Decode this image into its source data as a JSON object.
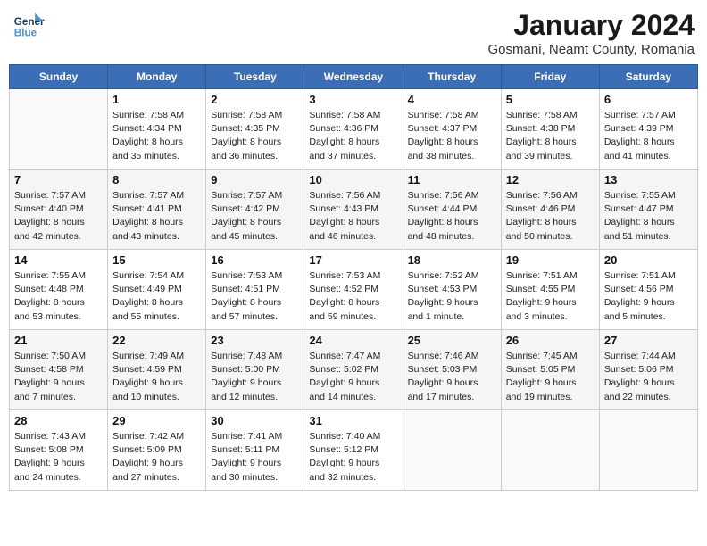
{
  "logo": {
    "line1": "General",
    "line2": "Blue"
  },
  "title": "January 2024",
  "subtitle": "Gosmani, Neamt County, Romania",
  "headers": [
    "Sunday",
    "Monday",
    "Tuesday",
    "Wednesday",
    "Thursday",
    "Friday",
    "Saturday"
  ],
  "weeks": [
    [
      {
        "day": "",
        "detail": ""
      },
      {
        "day": "1",
        "detail": "Sunrise: 7:58 AM\nSunset: 4:34 PM\nDaylight: 8 hours\nand 35 minutes."
      },
      {
        "day": "2",
        "detail": "Sunrise: 7:58 AM\nSunset: 4:35 PM\nDaylight: 8 hours\nand 36 minutes."
      },
      {
        "day": "3",
        "detail": "Sunrise: 7:58 AM\nSunset: 4:36 PM\nDaylight: 8 hours\nand 37 minutes."
      },
      {
        "day": "4",
        "detail": "Sunrise: 7:58 AM\nSunset: 4:37 PM\nDaylight: 8 hours\nand 38 minutes."
      },
      {
        "day": "5",
        "detail": "Sunrise: 7:58 AM\nSunset: 4:38 PM\nDaylight: 8 hours\nand 39 minutes."
      },
      {
        "day": "6",
        "detail": "Sunrise: 7:57 AM\nSunset: 4:39 PM\nDaylight: 8 hours\nand 41 minutes."
      }
    ],
    [
      {
        "day": "7",
        "detail": "Sunrise: 7:57 AM\nSunset: 4:40 PM\nDaylight: 8 hours\nand 42 minutes."
      },
      {
        "day": "8",
        "detail": "Sunrise: 7:57 AM\nSunset: 4:41 PM\nDaylight: 8 hours\nand 43 minutes."
      },
      {
        "day": "9",
        "detail": "Sunrise: 7:57 AM\nSunset: 4:42 PM\nDaylight: 8 hours\nand 45 minutes."
      },
      {
        "day": "10",
        "detail": "Sunrise: 7:56 AM\nSunset: 4:43 PM\nDaylight: 8 hours\nand 46 minutes."
      },
      {
        "day": "11",
        "detail": "Sunrise: 7:56 AM\nSunset: 4:44 PM\nDaylight: 8 hours\nand 48 minutes."
      },
      {
        "day": "12",
        "detail": "Sunrise: 7:56 AM\nSunset: 4:46 PM\nDaylight: 8 hours\nand 50 minutes."
      },
      {
        "day": "13",
        "detail": "Sunrise: 7:55 AM\nSunset: 4:47 PM\nDaylight: 8 hours\nand 51 minutes."
      }
    ],
    [
      {
        "day": "14",
        "detail": "Sunrise: 7:55 AM\nSunset: 4:48 PM\nDaylight: 8 hours\nand 53 minutes."
      },
      {
        "day": "15",
        "detail": "Sunrise: 7:54 AM\nSunset: 4:49 PM\nDaylight: 8 hours\nand 55 minutes."
      },
      {
        "day": "16",
        "detail": "Sunrise: 7:53 AM\nSunset: 4:51 PM\nDaylight: 8 hours\nand 57 minutes."
      },
      {
        "day": "17",
        "detail": "Sunrise: 7:53 AM\nSunset: 4:52 PM\nDaylight: 8 hours\nand 59 minutes."
      },
      {
        "day": "18",
        "detail": "Sunrise: 7:52 AM\nSunset: 4:53 PM\nDaylight: 9 hours\nand 1 minute."
      },
      {
        "day": "19",
        "detail": "Sunrise: 7:51 AM\nSunset: 4:55 PM\nDaylight: 9 hours\nand 3 minutes."
      },
      {
        "day": "20",
        "detail": "Sunrise: 7:51 AM\nSunset: 4:56 PM\nDaylight: 9 hours\nand 5 minutes."
      }
    ],
    [
      {
        "day": "21",
        "detail": "Sunrise: 7:50 AM\nSunset: 4:58 PM\nDaylight: 9 hours\nand 7 minutes."
      },
      {
        "day": "22",
        "detail": "Sunrise: 7:49 AM\nSunset: 4:59 PM\nDaylight: 9 hours\nand 10 minutes."
      },
      {
        "day": "23",
        "detail": "Sunrise: 7:48 AM\nSunset: 5:00 PM\nDaylight: 9 hours\nand 12 minutes."
      },
      {
        "day": "24",
        "detail": "Sunrise: 7:47 AM\nSunset: 5:02 PM\nDaylight: 9 hours\nand 14 minutes."
      },
      {
        "day": "25",
        "detail": "Sunrise: 7:46 AM\nSunset: 5:03 PM\nDaylight: 9 hours\nand 17 minutes."
      },
      {
        "day": "26",
        "detail": "Sunrise: 7:45 AM\nSunset: 5:05 PM\nDaylight: 9 hours\nand 19 minutes."
      },
      {
        "day": "27",
        "detail": "Sunrise: 7:44 AM\nSunset: 5:06 PM\nDaylight: 9 hours\nand 22 minutes."
      }
    ],
    [
      {
        "day": "28",
        "detail": "Sunrise: 7:43 AM\nSunset: 5:08 PM\nDaylight: 9 hours\nand 24 minutes."
      },
      {
        "day": "29",
        "detail": "Sunrise: 7:42 AM\nSunset: 5:09 PM\nDaylight: 9 hours\nand 27 minutes."
      },
      {
        "day": "30",
        "detail": "Sunrise: 7:41 AM\nSunset: 5:11 PM\nDaylight: 9 hours\nand 30 minutes."
      },
      {
        "day": "31",
        "detail": "Sunrise: 7:40 AM\nSunset: 5:12 PM\nDaylight: 9 hours\nand 32 minutes."
      },
      {
        "day": "",
        "detail": ""
      },
      {
        "day": "",
        "detail": ""
      },
      {
        "day": "",
        "detail": ""
      }
    ]
  ]
}
